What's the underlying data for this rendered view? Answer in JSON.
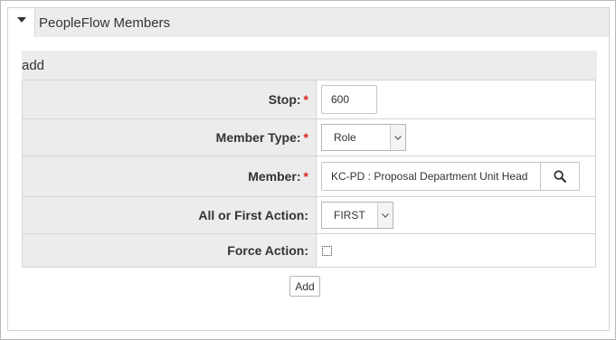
{
  "section": {
    "title": "PeopleFlow Members"
  },
  "subsection": {
    "title": "add"
  },
  "form": {
    "stop": {
      "label": "Stop:",
      "required_marker": "*",
      "value": "600"
    },
    "member_type": {
      "label": "Member Type:",
      "required_marker": "*",
      "selected": "Role"
    },
    "member": {
      "label": "Member:",
      "required_marker": "*",
      "value": "KC-PD : Proposal Department Unit Head"
    },
    "action": {
      "label": "All or First Action:",
      "selected": "FIRST"
    },
    "force_action": {
      "label": "Force Action:",
      "checked": false
    }
  },
  "buttons": {
    "add_label": "Add"
  },
  "icons": {
    "toggle": "triangle-down-icon",
    "search": "search-icon",
    "select_arrow": "chevron-down-icon"
  },
  "colors": {
    "required": "#d9261c",
    "header_bg": "#ececec",
    "border": "#d4d4d4"
  }
}
